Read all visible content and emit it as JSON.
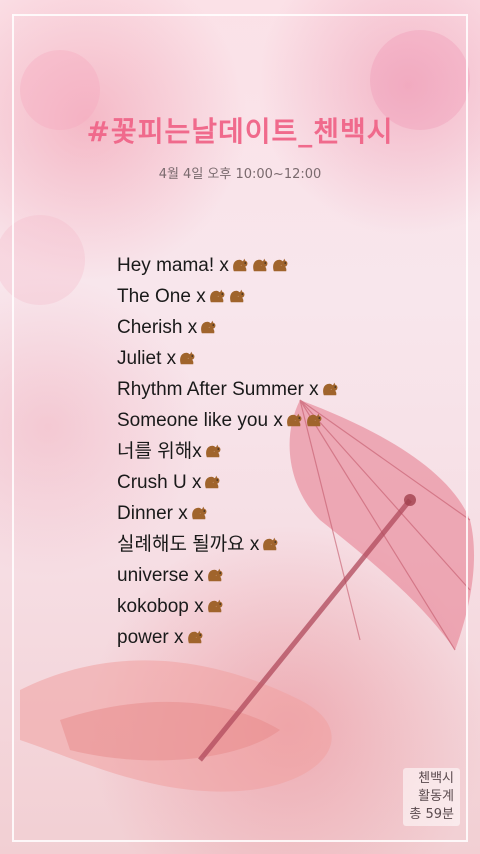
{
  "title": "#꽃피는날데이트_첸백시",
  "subtitle": "4월 4일 오후 10:00~12:00",
  "songs": [
    {
      "label": "Hey mama! x",
      "squirrels": 3
    },
    {
      "label": "The One x",
      "squirrels": 2
    },
    {
      "label": "Cherish x",
      "squirrels": 1
    },
    {
      "label": "Juliet x ",
      "squirrels": 1
    },
    {
      "label": "Rhythm After Summer x",
      "squirrels": 1
    },
    {
      "label": "Someone like you x",
      "squirrels": 2
    },
    {
      "label": "너를 위해x",
      "squirrels": 1
    },
    {
      "label": "Crush U x",
      "squirrels": 1
    },
    {
      "label": "Dinner x",
      "squirrels": 1
    },
    {
      "label": "실례해도 될까요 x",
      "squirrels": 1
    },
    {
      "label": "universe x ",
      "squirrels": 1
    },
    {
      "label": "kokobop x",
      "squirrels": 1
    },
    {
      "label": "power x",
      "squirrels": 1
    }
  ],
  "stamp": {
    "line1": "첸백시",
    "line2": "활동계",
    "line3": "총 59분"
  },
  "colors": {
    "title": "#f06a8c",
    "squirrel": "#a0642c"
  },
  "icons": {
    "squirrel": "squirrel-icon",
    "umbrella": "umbrella-illustration"
  }
}
